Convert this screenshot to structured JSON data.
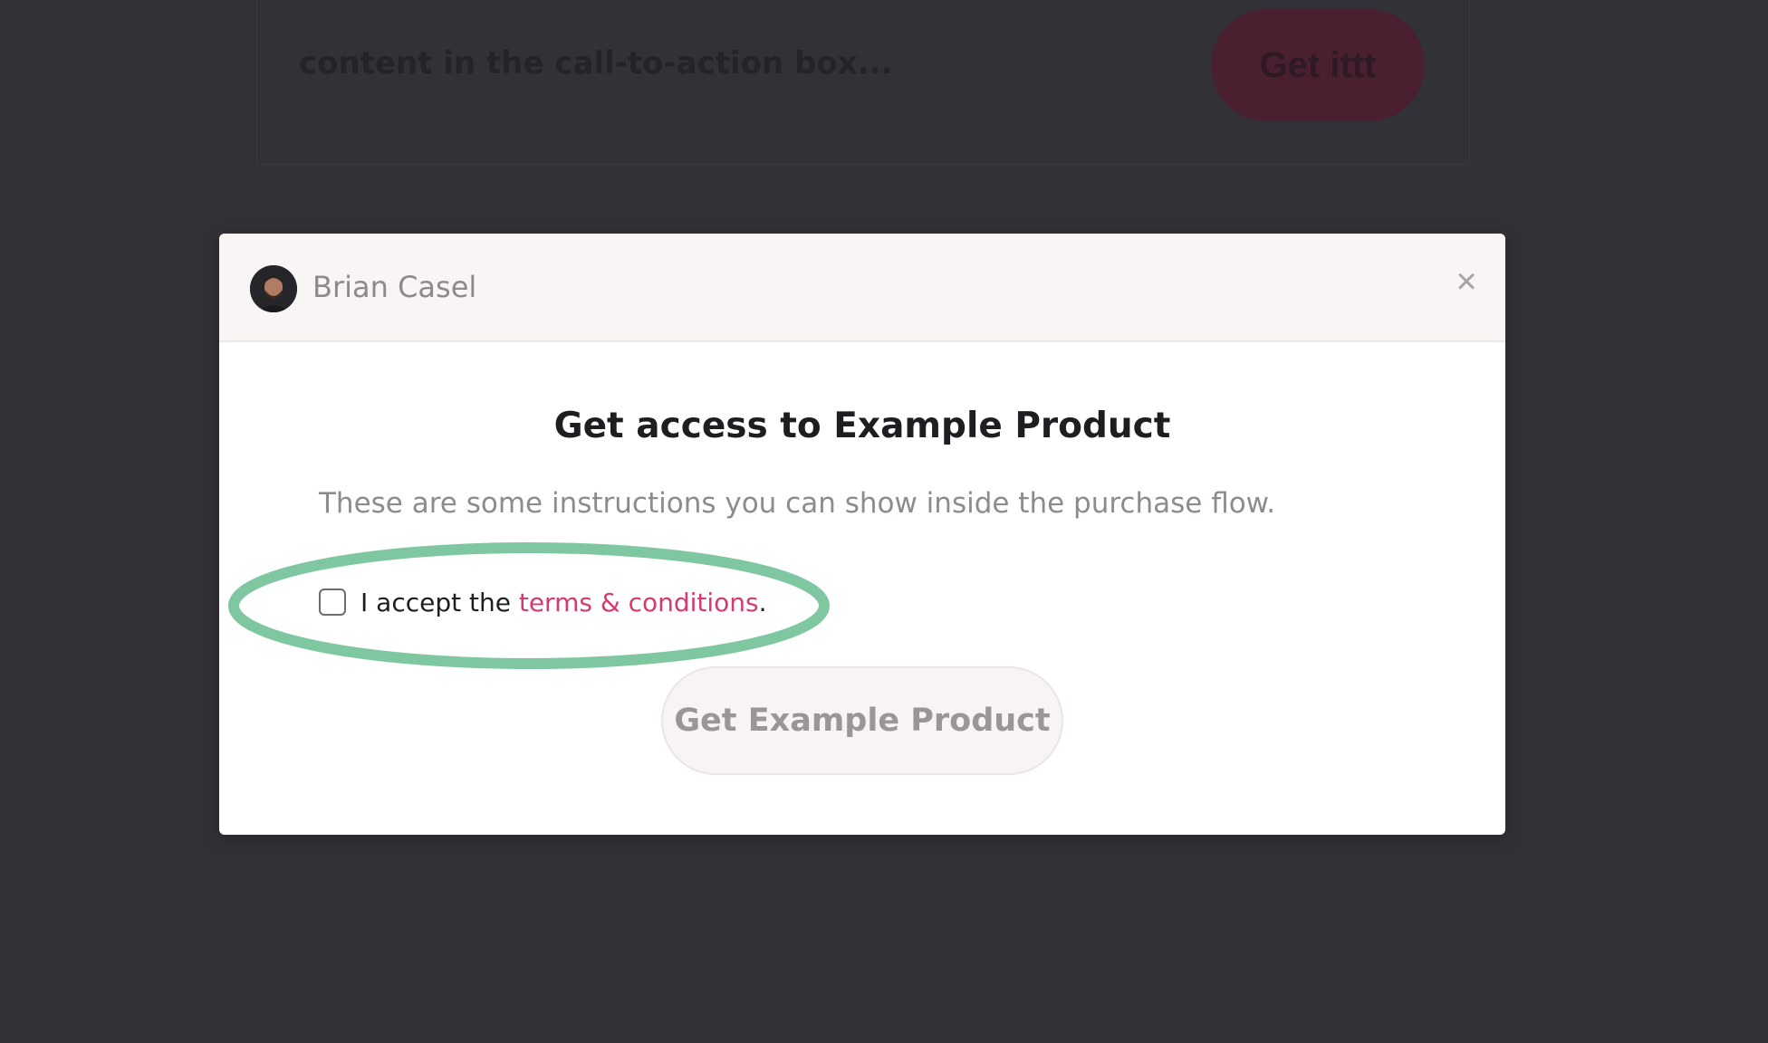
{
  "background": {
    "cta_text": "content in the call-to-action box...",
    "cta_button_label": "Get ittt"
  },
  "modal": {
    "author_name": "Brian Casel",
    "close_label": "×",
    "title": "Get access to Example Product",
    "instructions": "These are some instructions you can show inside the purchase flow.",
    "terms": {
      "prefix": "I accept the ",
      "link_text": "terms & conditions",
      "suffix": ".",
      "checked": false
    },
    "buy_button_label": "Get Example Product"
  },
  "colors": {
    "overlay": "#323137",
    "link": "#d63b6e",
    "highlight": "#7fc7a0"
  },
  "icons": {
    "close": "close-icon",
    "avatar": "avatar"
  }
}
